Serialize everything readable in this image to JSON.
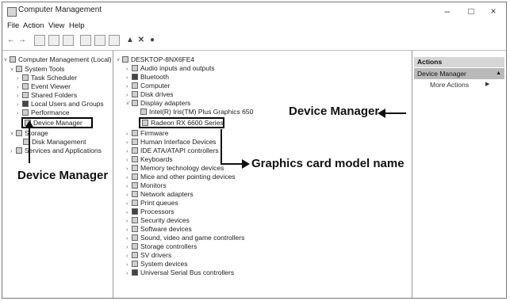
{
  "window": {
    "title": "Computer Management",
    "minimize": "–",
    "maximize": "□",
    "close": "×"
  },
  "menu": [
    "File",
    "Action",
    "View",
    "Help"
  ],
  "left_tree": [
    {
      "label": "Computer Management (Local)",
      "chev": "˅"
    },
    {
      "label": "System Tools",
      "chev": "˅"
    },
    {
      "label": "Task Scheduler",
      "chev": "›"
    },
    {
      "label": "Event Viewer",
      "chev": "›"
    },
    {
      "label": "Shared Folders",
      "chev": "›"
    },
    {
      "label": "Local Users and Groups",
      "chev": "›"
    },
    {
      "label": "Performance",
      "chev": "›"
    },
    {
      "label": "Device Manager",
      "chev": ""
    },
    {
      "label": "Storage",
      "chev": "˅"
    },
    {
      "label": "Disk Management",
      "chev": ""
    },
    {
      "label": "Services and Applications",
      "chev": "›"
    }
  ],
  "center_tree": [
    {
      "label": "DESKTOP-8NX6FE4",
      "chev": "˅"
    },
    {
      "label": "Audio inputs and outputs",
      "chev": "›"
    },
    {
      "label": "Bluetooth",
      "chev": "›"
    },
    {
      "label": "Computer",
      "chev": "›"
    },
    {
      "label": "Disk drives",
      "chev": "›"
    },
    {
      "label": "Display adapters",
      "chev": "˅"
    },
    {
      "label": "Intel(R) Iris(TM) Plus Graphics 650",
      "chev": ""
    },
    {
      "label": "Radeon RX 6600 Series",
      "chev": ""
    },
    {
      "label": "Firmware",
      "chev": "›"
    },
    {
      "label": "Human Interface Devices",
      "chev": "›"
    },
    {
      "label": "IDE ATA/ATAPI controllers",
      "chev": "›"
    },
    {
      "label": "Keyboards",
      "chev": "›"
    },
    {
      "label": "Memory technology devices",
      "chev": "›"
    },
    {
      "label": "Mice and other pointing devices",
      "chev": "›"
    },
    {
      "label": "Monitors",
      "chev": "›"
    },
    {
      "label": "Network adapters",
      "chev": "›"
    },
    {
      "label": "Print queues",
      "chev": "›"
    },
    {
      "label": "Processors",
      "chev": "›"
    },
    {
      "label": "Security devices",
      "chev": "›"
    },
    {
      "label": "Software devices",
      "chev": "›"
    },
    {
      "label": "Sound, video and game controllers",
      "chev": "›"
    },
    {
      "label": "Storage controllers",
      "chev": "›"
    },
    {
      "label": "SV drivers",
      "chev": "›"
    },
    {
      "label": "System devices",
      "chev": "›"
    },
    {
      "label": "Universal Serial Bus controllers",
      "chev": "›"
    }
  ],
  "actions": {
    "header": "Actions",
    "selected": "Device Manager",
    "selected_arrow": "▲",
    "more": "More Actions",
    "more_arrow": "▶"
  },
  "callouts": {
    "left": "Device Manager",
    "right": "Device Manager",
    "center": "Graphics card model name"
  }
}
